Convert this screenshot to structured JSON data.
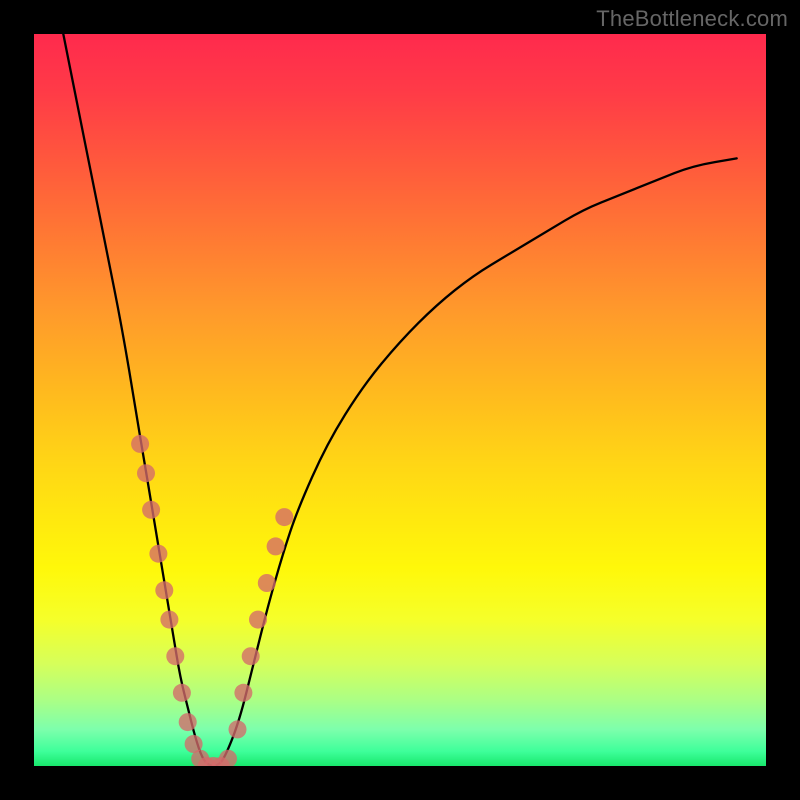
{
  "watermark": "TheBottleneck.com",
  "colors": {
    "dot": "#d46a6a",
    "curve": "#000000"
  },
  "chart_data": {
    "type": "line",
    "title": "",
    "xlabel": "",
    "ylabel": "",
    "xlim": [
      0,
      100
    ],
    "ylim": [
      0,
      100
    ],
    "grid": false,
    "legend": false,
    "annotations": [
      "TheBottleneck.com"
    ],
    "series": [
      {
        "name": "bottleneck-curve",
        "x": [
          4,
          6,
          8,
          10,
          12,
          14,
          15,
          16,
          17,
          18,
          19,
          20,
          21,
          22,
          23,
          24,
          25,
          26,
          28,
          30,
          32,
          34,
          36,
          40,
          45,
          50,
          55,
          60,
          65,
          70,
          75,
          80,
          85,
          90,
          96
        ],
        "y": [
          100,
          90,
          80,
          70,
          60,
          48,
          42,
          36,
          30,
          24,
          18,
          12,
          8,
          4,
          1,
          0,
          0,
          1,
          6,
          14,
          22,
          29,
          35,
          44,
          52,
          58,
          63,
          67,
          70,
          73,
          76,
          78,
          80,
          82,
          83
        ]
      }
    ],
    "scatter": [
      {
        "name": "marker-dots",
        "x": [
          14.5,
          15.3,
          16.0,
          17.0,
          17.8,
          18.5,
          19.3,
          20.2,
          21.0,
          21.8,
          22.7,
          23.6,
          24.5,
          25.5,
          26.5,
          27.8,
          28.6,
          29.6,
          30.6,
          31.8,
          33.0,
          34.2
        ],
        "y": [
          44,
          40,
          35,
          29,
          24,
          20,
          15,
          10,
          6,
          3,
          1,
          0,
          0,
          0,
          1,
          5,
          10,
          15,
          20,
          25,
          30,
          34
        ]
      }
    ]
  }
}
